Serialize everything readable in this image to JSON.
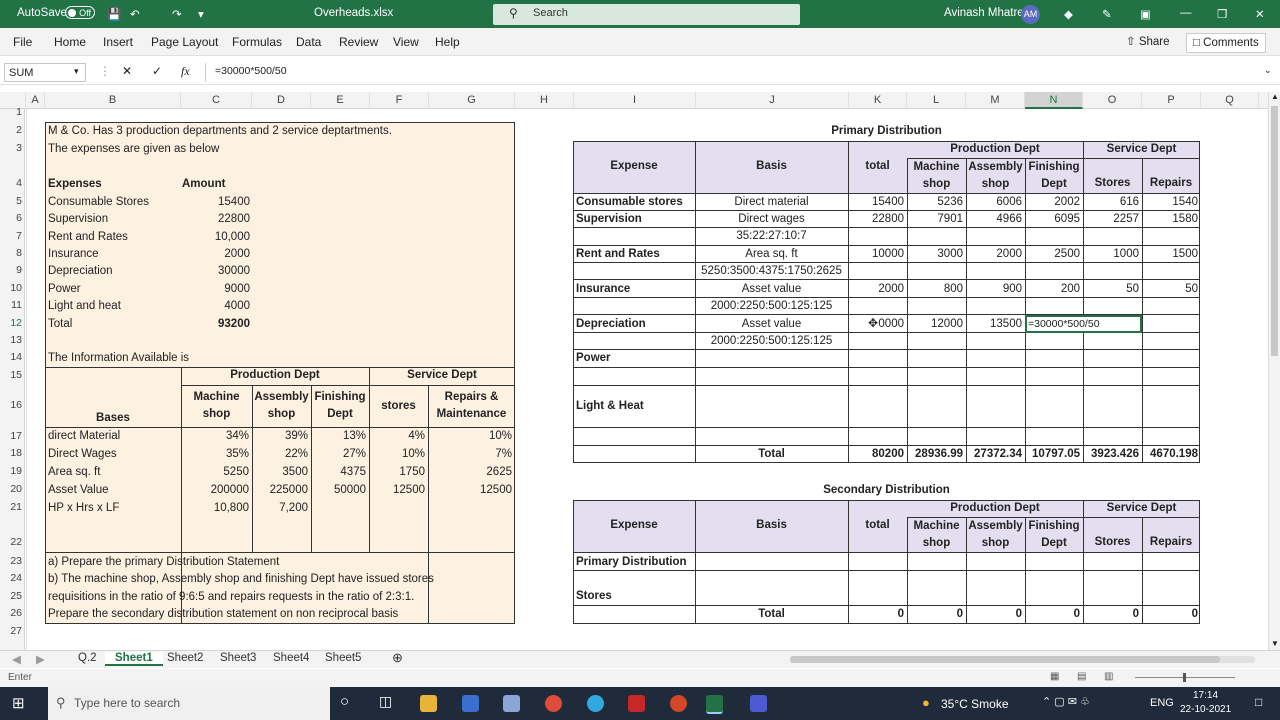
{
  "titlebar": {
    "autosave": "AutoSave",
    "autosave_state": "Off",
    "filename": "Overheads.xlsx",
    "search": "Search",
    "user": "Avinash Mhatre",
    "initials": "AM"
  },
  "menu": {
    "items": [
      "File",
      "Home",
      "Insert",
      "Page Layout",
      "Formulas",
      "Data",
      "Review",
      "View",
      "Help"
    ],
    "share": "Share",
    "comments": "Comments"
  },
  "formula_bar": {
    "name_box": "SUM",
    "formula": "=30000*500/50"
  },
  "columns": [
    "A",
    "B",
    "C",
    "D",
    "E",
    "F",
    "G",
    "H",
    "I",
    "J",
    "K",
    "L",
    "M",
    "N",
    "O",
    "P",
    "Q"
  ],
  "rows": [
    "1",
    "2",
    "3",
    "4",
    "5",
    "6",
    "7",
    "8",
    "9",
    "10",
    "11",
    "12",
    "13",
    "14",
    "15",
    "16",
    "17",
    "18",
    "19",
    "20",
    "21",
    "22",
    "23",
    "24",
    "25",
    "26",
    "27"
  ],
  "left": {
    "intro1": "M & Co.  Has 3 production departments and 2 service deptartments.",
    "intro2": "The expenses are given as below",
    "h_expenses": "Expenses",
    "h_amount": "Amount",
    "expenses": [
      {
        "name": "Consumable Stores",
        "amount": "15400"
      },
      {
        "name": "Supervision",
        "amount": "22800"
      },
      {
        "name": "Rent and Rates",
        "amount": "10,000"
      },
      {
        "name": "Insurance",
        "amount": "2000"
      },
      {
        "name": "Depreciation",
        "amount": "30000"
      },
      {
        "name": "Power",
        "amount": "9000"
      },
      {
        "name": "Light and heat",
        "amount": "4000"
      }
    ],
    "total_label": "Total",
    "total_value": "93200",
    "info": "The Information Available is",
    "prod_dept": "Production Dept",
    "serv_dept": "Service Dept",
    "bases": "Bases",
    "hdr": [
      "Machine shop",
      "Assembly shop",
      "Finishing Dept",
      "stores",
      "Repairs & Maintenance"
    ],
    "hdr_lines": [
      [
        "Machine",
        "shop"
      ],
      [
        "Assembly",
        "shop"
      ],
      [
        "Finishing",
        "Dept"
      ],
      [
        "stores",
        ""
      ],
      [
        "Repairs &",
        "Maintenance"
      ]
    ],
    "rows": [
      {
        "label": "direct Material",
        "v": [
          "34%",
          "39%",
          "13%",
          "4%",
          "10%"
        ]
      },
      {
        "label": "Direct Wages",
        "v": [
          "35%",
          "22%",
          "27%",
          "10%",
          "7%"
        ]
      },
      {
        "label": "Area sq. ft",
        "v": [
          "5250",
          "3500",
          "4375",
          "1750",
          "2625"
        ]
      },
      {
        "label": "Asset Value",
        "v": [
          "200000",
          "225000",
          "50000",
          "12500",
          "12500"
        ]
      },
      {
        "label": "HP x Hrs x LF",
        "v": [
          "10,800",
          "7,200",
          "",
          "",
          ""
        ]
      }
    ],
    "note_a": "a) Prepare the primary Distribution Statement",
    "note_b1": "b) The machine shop, Assembly shop and finishing Dept have issued stores",
    "note_b2": "requisitions in the ratio of 9:6:5 and repairs requests in the ratio of 2:3:1.",
    "note_b3": "Prepare the secondary distribution statement on non reciprocal basis"
  },
  "primary": {
    "title": "Primary Distribution",
    "h_expense": "Expense",
    "h_basis": "Basis",
    "h_total": "total",
    "prod_dept": "Production Dept",
    "serv_dept": "Service Dept",
    "dept_lines": [
      [
        "Machine",
        "shop"
      ],
      [
        "Assembly",
        "shop"
      ],
      [
        "Finishing",
        "Dept"
      ],
      [
        "Stores",
        ""
      ],
      [
        "Repairs",
        ""
      ]
    ],
    "rows": [
      {
        "expense": "Consumable stores",
        "basis": "Direct material",
        "total": "15400",
        "v": [
          "5236",
          "6006",
          "2002",
          "616",
          "1540"
        ]
      },
      {
        "expense": "Supervision",
        "basis": "Direct wages",
        "total": "22800",
        "v": [
          "7901",
          "4966",
          "6095",
          "2257",
          "1580"
        ]
      },
      {
        "expense": "",
        "basis": "35:22:27:10:7",
        "total": "",
        "v": [
          "",
          "",
          "",
          "",
          ""
        ]
      },
      {
        "expense": "Rent and Rates",
        "basis": "Area sq. ft",
        "total": "10000",
        "v": [
          "3000",
          "2000",
          "2500",
          "1000",
          "1500"
        ]
      },
      {
        "expense": "",
        "basis": "5250:3500:4375:1750:2625",
        "total": "",
        "v": [
          "",
          "",
          "",
          "",
          ""
        ]
      },
      {
        "expense": "Insurance",
        "basis": "Asset value",
        "total": "2000",
        "v": [
          "800",
          "900",
          "200",
          "50",
          "50"
        ]
      },
      {
        "expense": "",
        "basis": "2000:2250:500:125:125",
        "total": "",
        "v": [
          "",
          "",
          "",
          "",
          ""
        ]
      },
      {
        "expense": "Depreciation",
        "basis": "Asset value",
        "total": "0000",
        "v": [
          "12000",
          "13500",
          "=30000*500/50",
          "",
          ""
        ]
      },
      {
        "expense": "",
        "basis": "2000:2250:500:125:125",
        "total": "",
        "v": [
          "",
          "",
          "",
          "",
          ""
        ]
      },
      {
        "expense": "Power",
        "basis": "",
        "total": "",
        "v": [
          "",
          "",
          "",
          "",
          ""
        ]
      }
    ],
    "light_heat": "Light & Heat",
    "total_label": "Total",
    "total": "80200",
    "totals": [
      "28936.99",
      "27372.34",
      "10797.05",
      "3923.426",
      "4670.198"
    ]
  },
  "secondary": {
    "title": "Secondary Distribution",
    "primary_label": "Primary Distribution",
    "stores_label": "Stores",
    "total_label": "Total",
    "totals": [
      "0",
      "0",
      "0",
      "0",
      "0",
      "0"
    ]
  },
  "sheets": [
    "Q.2",
    "Sheet1",
    "Sheet2",
    "Sheet3",
    "Sheet4",
    "Sheet5"
  ],
  "status": {
    "mode": "Enter"
  },
  "taskbar": {
    "search": "Type here to search",
    "weather": "35°C  Smoke",
    "lang": "ENG",
    "time": "17:14",
    "date": "22-10-2021"
  }
}
